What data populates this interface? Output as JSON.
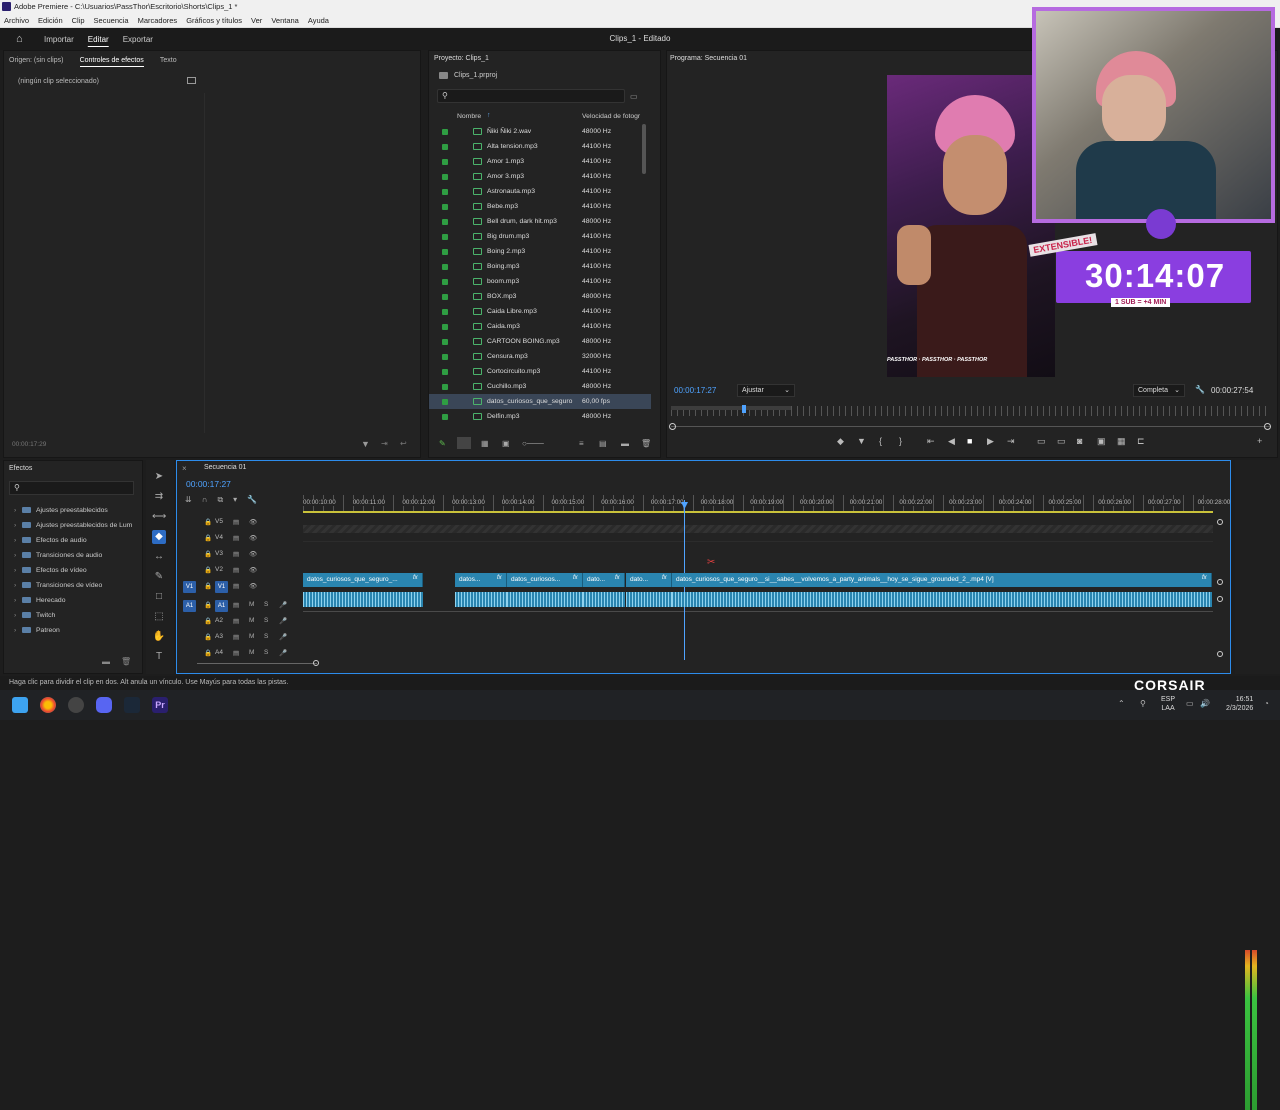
{
  "app": {
    "title": "Adobe Premiere - C:\\Usuarios\\PassThor\\Escritorio\\Shorts\\Clips_1 *",
    "menu": [
      "Archivo",
      "Edición",
      "Clip",
      "Secuencia",
      "Marcadores",
      "Gráficos y títulos",
      "Ver",
      "Ventana",
      "Ayuda"
    ],
    "workspaces": [
      "Importar",
      "Editar",
      "Exportar"
    ],
    "active_workspace": "Editar",
    "document_title": "Clips_1 - Editado"
  },
  "source_panel": {
    "tabs": [
      "Origen: (sin clips)",
      "Controles de efectos",
      "Texto"
    ],
    "active_tab": "Controles de efectos",
    "empty_text": "(ningún clip seleccionado)",
    "timecode": "00:00:17:29"
  },
  "project_panel": {
    "title": "Proyecto: Clips_1",
    "file": "Clips_1.prproj",
    "col_name": "Nombre",
    "col_rate": "Velocidad de fotogr",
    "items": [
      {
        "name": "Ñiki Ñiki 2.wav",
        "rate": "48000 Hz"
      },
      {
        "name": "Alta tension.mp3",
        "rate": "44100 Hz"
      },
      {
        "name": "Amor 1.mp3",
        "rate": "44100 Hz"
      },
      {
        "name": "Amor 3.mp3",
        "rate": "44100 Hz"
      },
      {
        "name": "Astronauta.mp3",
        "rate": "44100 Hz"
      },
      {
        "name": "Bebe.mp3",
        "rate": "44100 Hz"
      },
      {
        "name": "Bell drum, dark hit.mp3",
        "rate": "48000 Hz"
      },
      {
        "name": "Big drum.mp3",
        "rate": "44100 Hz"
      },
      {
        "name": "Boing 2.mp3",
        "rate": "44100 Hz"
      },
      {
        "name": "Boing.mp3",
        "rate": "44100 Hz"
      },
      {
        "name": "boom.mp3",
        "rate": "44100 Hz"
      },
      {
        "name": "BOX.mp3",
        "rate": "48000 Hz"
      },
      {
        "name": "Caida Libre.mp3",
        "rate": "44100 Hz"
      },
      {
        "name": "Caida.mp3",
        "rate": "44100 Hz"
      },
      {
        "name": "CARTOON BOING.mp3",
        "rate": "48000 Hz"
      },
      {
        "name": "Censura.mp3",
        "rate": "32000 Hz"
      },
      {
        "name": "Cortocircuito.mp3",
        "rate": "44100 Hz"
      },
      {
        "name": "Cuchillo.mp3",
        "rate": "48000 Hz"
      },
      {
        "name": "datos_curiosos_que_seguro",
        "rate": "60,00 fps"
      },
      {
        "name": "Delfin.mp3",
        "rate": "48000 Hz"
      }
    ],
    "selected_index": 18
  },
  "program_panel": {
    "title": "Programa: Secuencia 01",
    "timecode": "00:00:17:27",
    "fit": "Ajustar",
    "quality": "Completa",
    "duration": "00:00:27:54",
    "overlay": {
      "badge": "EXTENSIBLE!",
      "timer": "30:14:07",
      "sub": "1 SUB = +4 MIN",
      "watermark": "PASSTHOR"
    }
  },
  "effects_panel": {
    "title": "Efectos",
    "items": [
      "Ajustes preestablecidos",
      "Ajustes preestablecidos de Lum",
      "Efectos de audio",
      "Transiciones de audio",
      "Efectos de vídeo",
      "Transiciones de vídeo",
      "Herecado",
      "Twitch",
      "Patreon"
    ]
  },
  "sequence_panel": {
    "title": "Secuencia 01",
    "timecode": "00:00:17:27",
    "ruler": [
      "00:00:10:00",
      "00:00:11:00",
      "00:00:12:00",
      "00:00:13:00",
      "00:00:14:00",
      "00:00:15:00",
      "00:00:16:00",
      "00:00:17:00",
      "00:00:18:00",
      "00:00:19:00",
      "00:00:20:00",
      "00:00:21:00",
      "00:00:22:00",
      "00:00:23:00",
      "00:00:24:00",
      "00:00:25:00",
      "00:00:26:00",
      "00:00:27:00",
      "00:00:28:00"
    ],
    "tracks": [
      {
        "name": "V5"
      },
      {
        "name": "V4"
      },
      {
        "name": "V3"
      },
      {
        "name": "V2"
      },
      {
        "name": "V1",
        "src": "V1"
      },
      {
        "name": "A1",
        "src": "A1"
      },
      {
        "name": "A2"
      },
      {
        "name": "A3"
      },
      {
        "name": "A4"
      }
    ],
    "clips": [
      "datos_curiosos_que_seguro_...",
      "datos...",
      "datos_curiosos...",
      "dato...",
      "dato...",
      "datos_curiosos_que_seguro__si__sabes__volvemos_a_party_animals__hoy_se_sigue_grounded_2_.mp4 [V]"
    ],
    "fx_label": "fx"
  },
  "status_bar": "Haga clic para dividir el clip en dos. Alt anula un vínculo. Use Mayús para todas las pistas.",
  "taskbar": {
    "lang1": "ESP",
    "lang2": "LAA",
    "time": "16:51",
    "date": "2/3/2026",
    "brand": "CORSAIR"
  },
  "colors": {
    "accent": "#2d8ceb",
    "clip": "#2a85b0",
    "timer_bg": "#8a3ee0"
  }
}
